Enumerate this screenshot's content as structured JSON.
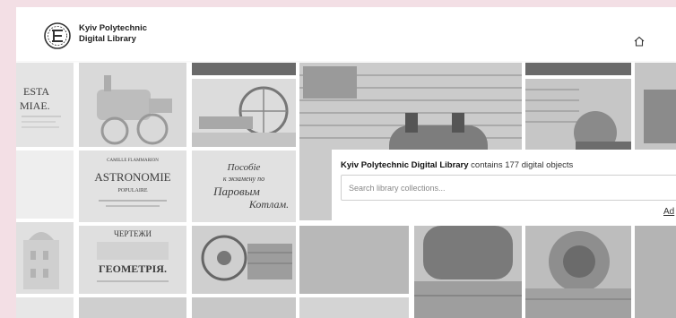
{
  "header": {
    "logo_line1": "Kyiv Polytechnic",
    "logo_line2": "Digital Library",
    "home_icon": "home-icon"
  },
  "tiles": {
    "astronomie_title": "ASTRONOMIE",
    "astronomie_sub": "POPULAIRE",
    "astronomie_top": "CAMILLE FLAMMARION",
    "posobie_line1": "Пособіе",
    "posobie_line2": "к экзамену по",
    "posobie_line3": "Паровым",
    "posobie_line4": "Котлам.",
    "geometria_top": "ЧЕРТЕЖИ",
    "geometria_title": "ГЕОМЕТРІЯ.",
    "latin_line1": "ESTA",
    "latin_line2": "MIAE."
  },
  "search": {
    "heading_bold": "Kyiv Polytechnic Digital Library",
    "heading_rest": " contains 177 digital objects",
    "placeholder": "Search library collections...",
    "advanced_label": "Ad"
  }
}
